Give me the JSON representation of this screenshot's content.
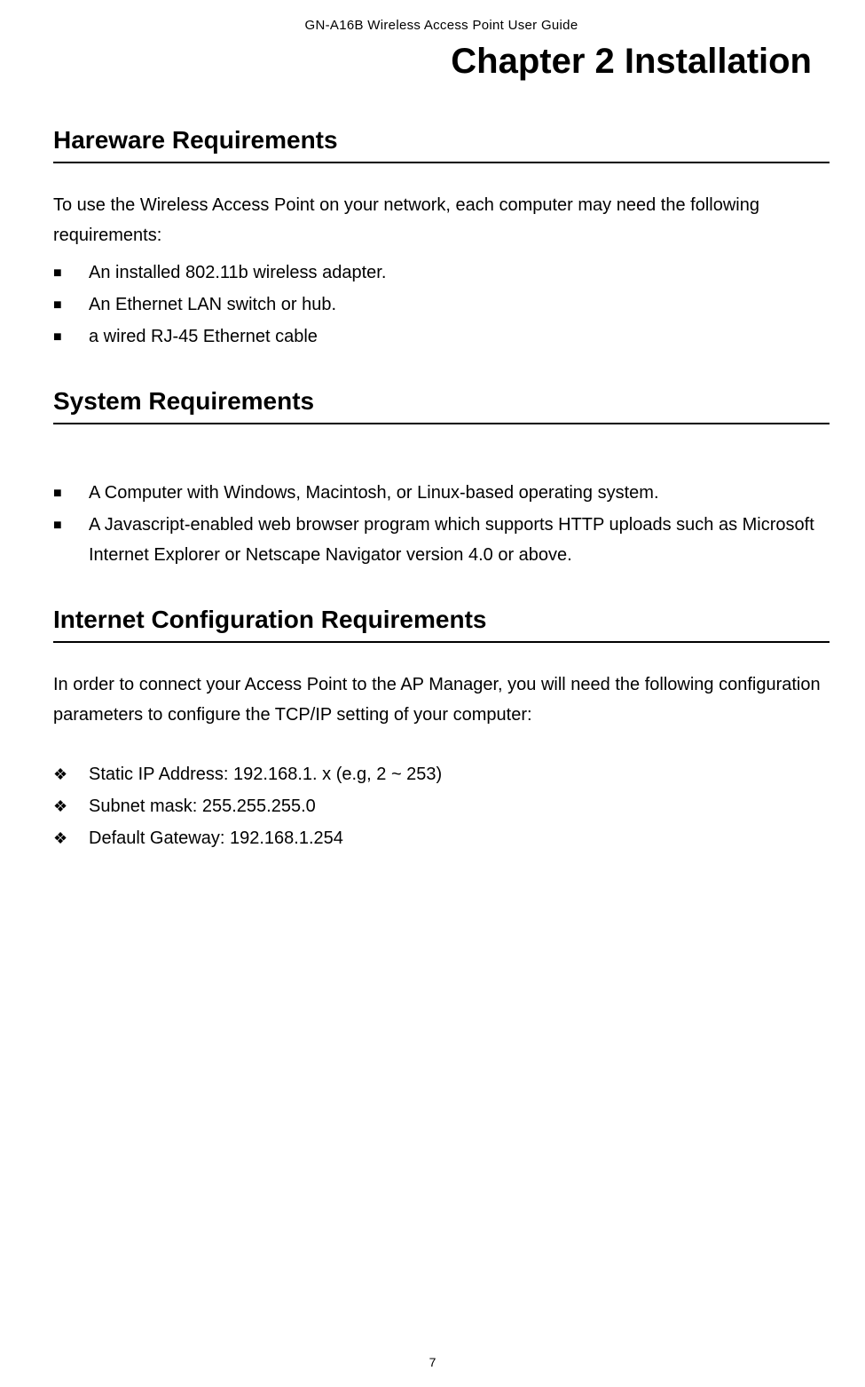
{
  "header": "GN-A16B Wireless Access Point User Guide",
  "chapterTitle": "Chapter 2  Installation",
  "sections": {
    "hardware": {
      "heading": "Hareware Requirements",
      "intro": "To use the Wireless Access Point on your network, each computer may need the following requirements:",
      "items": [
        "An installed 802.11b wireless adapter.",
        "An Ethernet LAN switch or hub.",
        "a wired RJ-45 Ethernet cable"
      ]
    },
    "system": {
      "heading": "System Requirements",
      "items": [
        "A Computer with Windows, Macintosh, or Linux-based operating system.",
        "A Javascript-enabled web browser program which supports  HTTP uploads such as Microsoft Internet Explorer or Netscape Navigator version 4.0 or above."
      ]
    },
    "internet": {
      "heading": "Internet Configuration Requirements",
      "intro": "In order to connect your Access Point to the AP Manager, you will need the following configuration parameters to configure the TCP/IP setting of your computer:",
      "items": [
        "Static IP Address: 192.168.1. x (e.g, 2 ~ 253)",
        "Subnet mask: 255.255.255.0",
        "Default Gateway: 192.168.1.254"
      ]
    }
  },
  "pageNumber": "7"
}
